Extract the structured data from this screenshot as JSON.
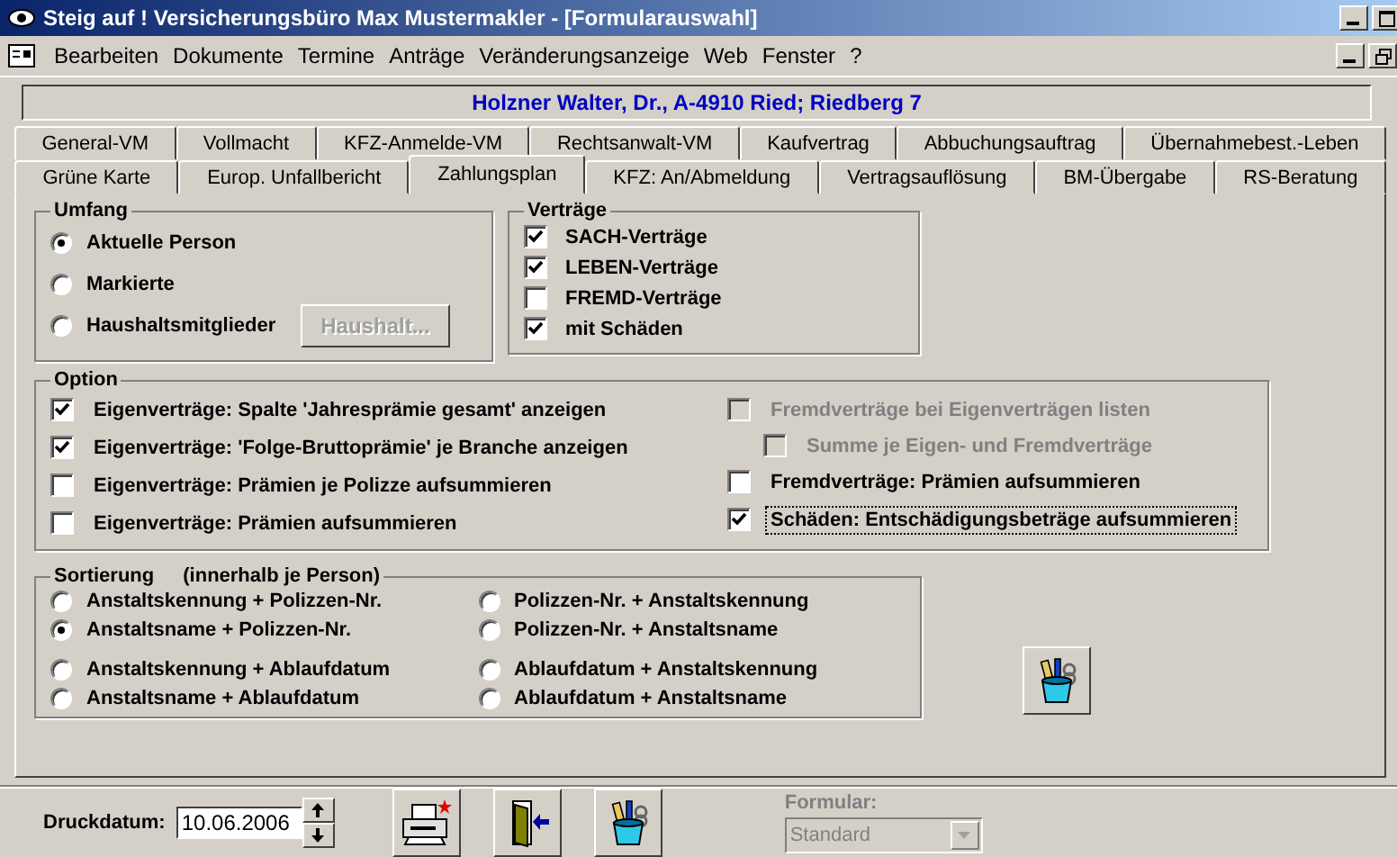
{
  "window": {
    "title": "Steig auf ! Versicherungsbüro Max Mustermakler - [Formularauswahl]"
  },
  "menu": [
    "Bearbeiten",
    "Dokumente",
    "Termine",
    "Anträge",
    "Veränderungsanzeige",
    "Web",
    "Fenster",
    "?"
  ],
  "person_banner": "Holzner Walter, Dr., A-4910 Ried; Riedberg 7",
  "tab_rows": [
    [
      {
        "label": "General-VM",
        "selected": false
      },
      {
        "label": "Vollmacht",
        "selected": false
      },
      {
        "label": "KFZ-Anmelde-VM",
        "selected": false
      },
      {
        "label": "Rechtsanwalt-VM",
        "selected": false
      },
      {
        "label": "Kaufvertrag",
        "selected": false
      },
      {
        "label": "Abbuchungsauftrag",
        "selected": false
      },
      {
        "label": "Übernahmebest.-Leben",
        "selected": false
      }
    ],
    [
      {
        "label": "Grüne Karte",
        "selected": false
      },
      {
        "label": "Europ. Unfallbericht",
        "selected": false
      },
      {
        "label": "Zahlungsplan",
        "selected": true
      },
      {
        "label": "KFZ: An/Abmeldung",
        "selected": false
      },
      {
        "label": "Vertragsauflösung",
        "selected": false
      },
      {
        "label": "BM-Übergabe",
        "selected": false
      },
      {
        "label": "RS-Beratung",
        "selected": false
      }
    ]
  ],
  "umfang": {
    "title": "Umfang",
    "options": [
      {
        "label": "Aktuelle Person",
        "selected": true
      },
      {
        "label": "Markierte",
        "selected": false
      },
      {
        "label": "Haushaltsmitglieder",
        "selected": false
      }
    ],
    "button": {
      "label": "Haushalt...",
      "disabled": true
    }
  },
  "vertraege": {
    "title": "Verträge",
    "items": [
      {
        "label": "SACH-Verträge",
        "checked": true
      },
      {
        "label": "LEBEN-Verträge",
        "checked": true
      },
      {
        "label": "FREMD-Verträge",
        "checked": false
      },
      {
        "label": "mit Schäden",
        "checked": true
      }
    ]
  },
  "option": {
    "title": "Option",
    "left": [
      {
        "label": "Eigenverträge: Spalte 'Jahresprämie gesamt' anzeigen",
        "checked": true,
        "disabled": false,
        "focused": false
      },
      {
        "label": "Eigenverträge: 'Folge-Bruttoprämie' je Branche anzeigen",
        "checked": true,
        "disabled": false,
        "focused": false
      },
      {
        "label": "Eigenverträge: Prämien je Polizze aufsummieren",
        "checked": false,
        "disabled": false,
        "focused": false
      },
      {
        "label": "Eigenverträge: Prämien aufsummieren",
        "checked": false,
        "disabled": false,
        "focused": false
      }
    ],
    "right": [
      {
        "label": "Fremdverträge bei Eigenverträgen listen",
        "checked": false,
        "disabled": true,
        "focused": false,
        "children": [
          {
            "label": "Summe je Eigen- und Fremdverträge",
            "checked": false,
            "disabled": true,
            "focused": false
          }
        ]
      },
      {
        "label": "Fremdverträge: Prämien aufsummieren",
        "checked": false,
        "disabled": false,
        "focused": false
      },
      {
        "label": "Schäden: Entschädigungsbeträge aufsummieren",
        "checked": true,
        "disabled": false,
        "focused": true
      }
    ]
  },
  "sortierung": {
    "title": "Sortierung",
    "subtitle": "(innerhalb je Person)",
    "columns": [
      [
        {
          "label": "Anstaltskennung + Polizzen-Nr.",
          "selected": false
        },
        {
          "label": "Anstaltsname + Polizzen-Nr.",
          "selected": true
        },
        {
          "label": "Anstaltskennung + Ablaufdatum",
          "selected": false
        },
        {
          "label": "Anstaltsname + Ablaufdatum",
          "selected": false
        }
      ],
      [
        {
          "label": "Polizzen-Nr. + Anstaltskennung",
          "selected": false
        },
        {
          "label": "Polizzen-Nr. + Anstaltsname",
          "selected": false
        },
        {
          "label": "Ablaufdatum + Anstaltskennung",
          "selected": false
        },
        {
          "label": "Ablaufdatum + Anstaltsname",
          "selected": false
        }
      ]
    ]
  },
  "bottom": {
    "date_label": "Druckdatum:",
    "date_value": "10.06.2006",
    "formular_label": "Formular:",
    "formular_value": "Standard",
    "formular_disabled": true
  }
}
